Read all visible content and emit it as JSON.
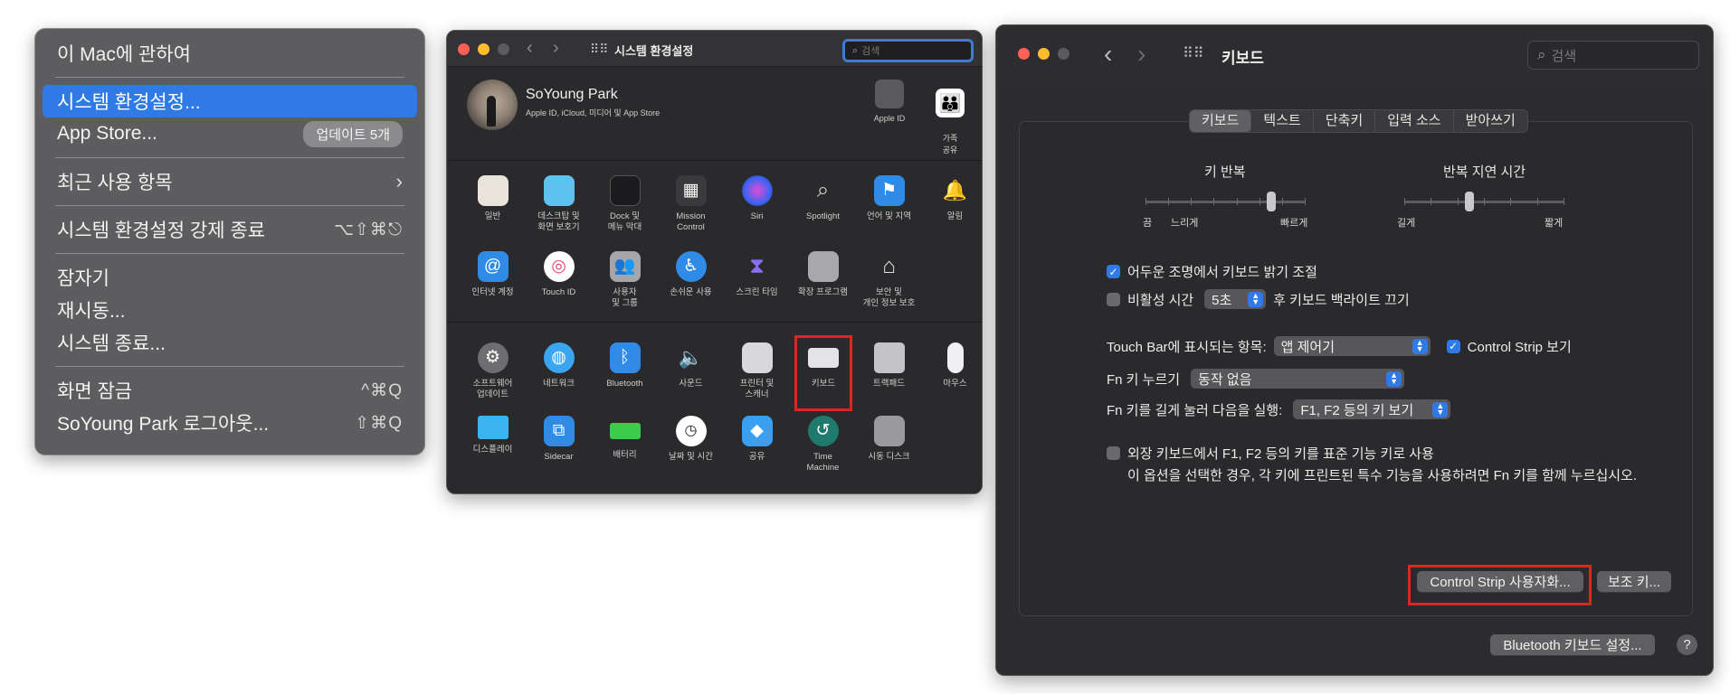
{
  "apple_menu": {
    "items": [
      {
        "label": "이 Mac에 관하여"
      },
      {
        "label": "시스템 환경설정..."
      },
      {
        "label": "App Store...",
        "badge": "업데이트 5개"
      },
      {
        "label": "최근 사용 항목"
      },
      {
        "label": "시스템 환경설정 강제 종료",
        "shortcut": "⌥⇧⌘⎋"
      },
      {
        "label": "잠자기"
      },
      {
        "label": "재시동..."
      },
      {
        "label": "시스템 종료..."
      },
      {
        "label": "화면 잠금",
        "shortcut": "^⌘Q"
      },
      {
        "label": "SoYoung Park 로그아웃...",
        "shortcut": "⇧⌘Q"
      }
    ]
  },
  "syspref": {
    "title": "시스템 환경설정",
    "search_placeholder": "검색",
    "user_name": "SoYoung Park",
    "user_sub": "Apple ID, iCloud, 미디어 및 App Store",
    "apple_id_label": "Apple ID",
    "family_label": "가족\n공유",
    "row1": [
      "일반",
      "데스크탑 및\n화면 보호기",
      "Dock 및\n메뉴 막대",
      "Mission\nControl",
      "Siri",
      "Spotlight",
      "언어 및 지역",
      "알림"
    ],
    "row2": [
      "인터넷 계정",
      "Touch ID",
      "사용자\n및 그룹",
      "손쉬운 사용",
      "스크린 타임",
      "확장 프로그램",
      "보안 및\n개인 정보 보호"
    ],
    "row3": [
      "소프트웨어\n업데이트",
      "네트워크",
      "Bluetooth",
      "사운드",
      "프린터 및\n스캐너",
      "키보드",
      "트랙패드",
      "마우스"
    ],
    "row4": [
      "디스플레이",
      "Sidecar",
      "배터리",
      "날짜 및 시간",
      "공유",
      "Time\nMachine",
      "시동 디스크"
    ]
  },
  "keyboard": {
    "title": "키보드",
    "search_placeholder": "검색",
    "tabs": [
      "키보드",
      "텍스트",
      "단축키",
      "입력 소스",
      "받아쓰기"
    ],
    "key_repeat_label": "키 반복",
    "key_repeat_left": "끔",
    "key_repeat_mid": "느리게",
    "key_repeat_right": "빠르게",
    "delay_label": "반복 지연 시간",
    "delay_left": "길게",
    "delay_right": "짧게",
    "key_repeat_level": 0.8,
    "delay_level": 0.4,
    "adjust_brightness": "어두운 조명에서 키보드 밝기 조절",
    "idle_prefix": "비활성 시간",
    "idle_value": "5초",
    "idle_suffix": "후 키보드 백라이트 끄기",
    "touchbar_label": "Touch Bar에 표시되는 항목:",
    "touchbar_value": "앱 제어기",
    "control_strip_label": "Control Strip 보기",
    "fn_label": "Fn 키 누르기",
    "fn_value": "동작 없음",
    "fn_hold_label": "Fn 키를 길게 눌러 다음을 실행:",
    "fn_hold_value": "F1, F2 등의 키 보기",
    "external_fn_label": "외장 키보드에서 F1, F2 등의 키를 표준 기능 키로 사용",
    "external_fn_note": "이 옵션을 선택한 경우, 각 키에 프린트된 특수 기능을 사용하려면 Fn 키를 함께 누르십시오.",
    "customize_button": "Control Strip 사용자화...",
    "modifier_button": "보조 키...",
    "bluetooth_button": "Bluetooth 키보드 설정...",
    "help": "?"
  }
}
